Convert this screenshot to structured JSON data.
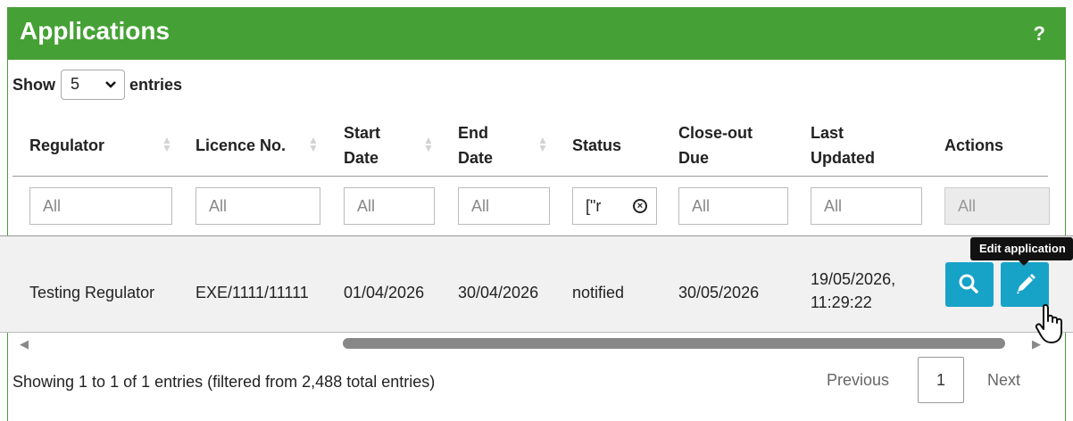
{
  "panel": {
    "title": "Applications",
    "help_label": "?"
  },
  "length_menu": {
    "show_label": "Show",
    "selected": "5",
    "entries_label": "entries"
  },
  "table": {
    "columns": [
      {
        "line1": "Regulator",
        "line2": ""
      },
      {
        "line1": "Licence No.",
        "line2": ""
      },
      {
        "line1": "Start",
        "line2": "Date"
      },
      {
        "line1": "End",
        "line2": "Date"
      },
      {
        "line1": "Status",
        "line2": ""
      },
      {
        "line1": "Close-out",
        "line2": "Due"
      },
      {
        "line1": "Last",
        "line2": "Updated"
      },
      {
        "line1": "Actions",
        "line2": ""
      }
    ],
    "filters": [
      {
        "value": "All"
      },
      {
        "value": "All"
      },
      {
        "value": "All"
      },
      {
        "value": "All"
      },
      {
        "value": "[\"r"
      },
      {
        "value": "All"
      },
      {
        "value": "All"
      },
      {
        "value": "All"
      }
    ],
    "rows": [
      {
        "regulator": "Testing Regulator",
        "licence_no": "EXE/1111/11111",
        "start_date": "01/04/2026",
        "end_date": "30/04/2026",
        "status": "notified",
        "close_out_due": "30/05/2026",
        "last_updated_line1": "19/05/2026,",
        "last_updated_line2": "11:29:22"
      }
    ]
  },
  "actions": {
    "view_icon": "search-icon",
    "edit_icon": "pencil-icon",
    "edit_tooltip": "Edit application"
  },
  "footer": {
    "info": "Showing 1 to 1 of 1 entries (filtered from 2,488 total entries)",
    "previous": "Previous",
    "current_page": "1",
    "next": "Next"
  },
  "colors": {
    "header_green": "#45a135",
    "action_blue": "#17a2c8",
    "row_bg": "#f1f1f1"
  }
}
